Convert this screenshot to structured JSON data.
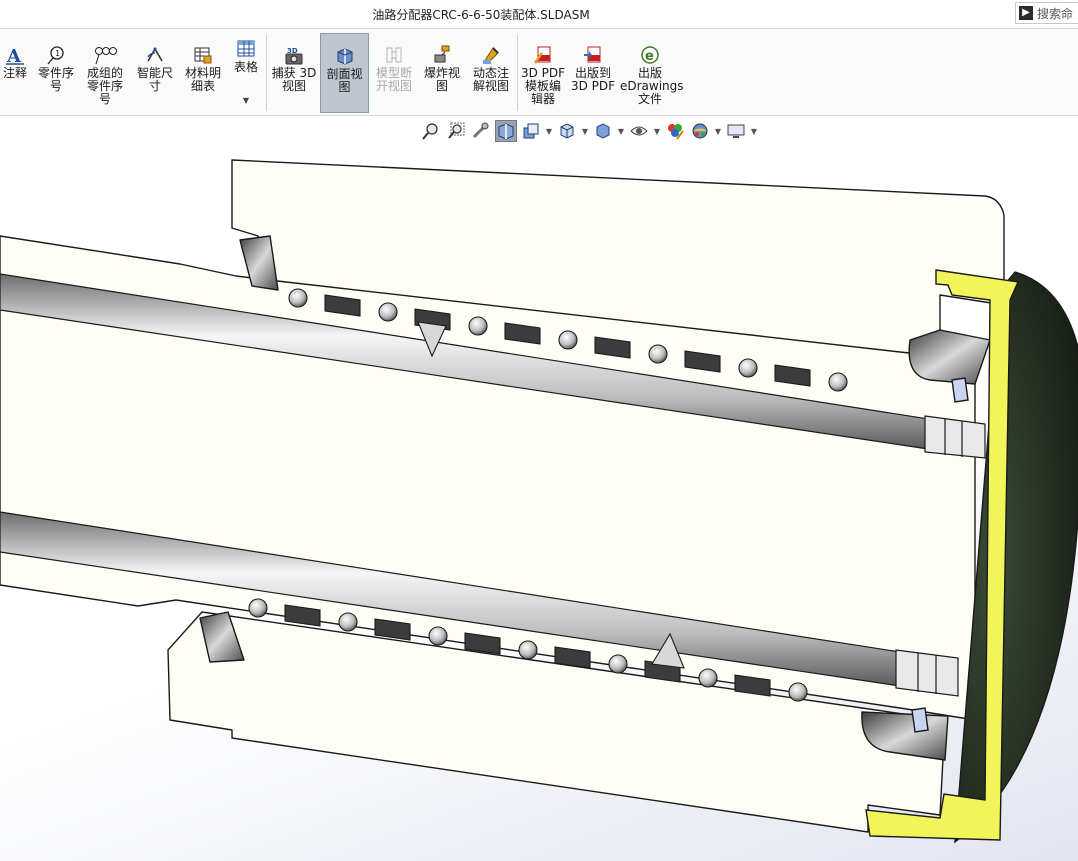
{
  "window": {
    "title": "油路分配器CRC-6-6-50装配体.SLDASM"
  },
  "search": {
    "label": "搜索命"
  },
  "ribbon": {
    "tools": [
      {
        "id": "annotation",
        "label": "注释",
        "icon": "annotation-icon"
      },
      {
        "id": "balloon",
        "label": "零件序\n号",
        "icon": "balloon-icon"
      },
      {
        "id": "stacked-balloon",
        "label": "成组的\n零件序\n号",
        "icon": "stacked-balloon-icon"
      },
      {
        "id": "smart-dimension",
        "label": "智能尺\n寸",
        "icon": "smart-dimension-icon"
      },
      {
        "id": "bom",
        "label": "材料明\n细表",
        "icon": "bom-icon"
      },
      {
        "id": "table",
        "label": "表格",
        "icon": "table-icon"
      },
      {
        "id": "capture-3d-view",
        "label": "捕获 3D\n视图",
        "icon": "camera-3d-icon"
      },
      {
        "id": "section-view",
        "label": "剖面视\n图",
        "icon": "section-view-icon",
        "state": "active"
      },
      {
        "id": "model-break-view",
        "label": "模型断\n开视图",
        "icon": "break-view-icon",
        "state": "disabled"
      },
      {
        "id": "exploded-view",
        "label": "爆炸视\n图",
        "icon": "exploded-view-icon"
      },
      {
        "id": "dynamic-annotation",
        "label": "动态注\n解视图",
        "icon": "dynamic-annotation-icon"
      },
      {
        "id": "pdf-template-editor",
        "label": "3D PDF\n模板编\n辑器",
        "icon": "pdf-template-icon"
      },
      {
        "id": "publish-3d-pdf",
        "label": "出版到\n3D PDF",
        "icon": "publish-pdf-icon"
      },
      {
        "id": "publish-edrawings",
        "label": "出版\neDrawings\n文件",
        "icon": "edrawings-icon"
      }
    ]
  },
  "headsup": {
    "buttons": [
      {
        "name": "zoom-to-fit-icon"
      },
      {
        "name": "zoom-to-area-icon"
      },
      {
        "name": "previous-view-icon"
      },
      {
        "name": "section-view-toggle-icon",
        "active": true
      },
      {
        "name": "dynamic-annotation-views-icon",
        "dropdown": true
      },
      {
        "name": "view-orientation-icon",
        "dropdown": true
      },
      {
        "name": "display-style-icon",
        "dropdown": true
      },
      {
        "name": "hide-show-items-icon",
        "dropdown": true
      },
      {
        "name": "edit-appearance-icon"
      },
      {
        "name": "apply-scene-icon",
        "dropdown": true
      },
      {
        "name": "view-settings-icon",
        "dropdown": true
      }
    ]
  },
  "colors": {
    "part_fill": "#fffef6",
    "edge": "#1a1a1a",
    "cap_highlight": "#f2f55a",
    "cap_dark": "#1f281e",
    "active_tool_bg": "#bfc6cf"
  }
}
